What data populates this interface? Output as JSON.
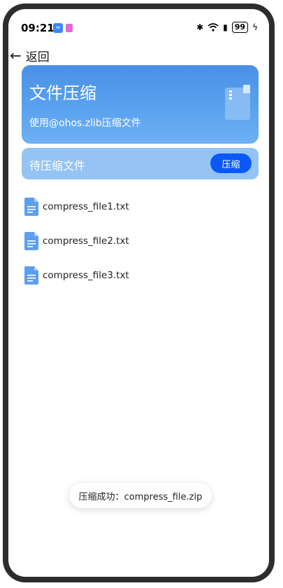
{
  "status_bar": {
    "time": "09:21",
    "battery": "99",
    "icons": [
      "bluetooth-icon",
      "wifi-icon",
      "sim-icon",
      "battery-icon",
      "charging-icon"
    ]
  },
  "nav": {
    "back_label": "返回"
  },
  "header_card": {
    "title": "文件压缩",
    "subtitle": "使用@ohos.zlib压缩文件"
  },
  "pending": {
    "label": "待压缩文件",
    "button_label": "压缩"
  },
  "files": [
    {
      "name": "compress_file1.txt"
    },
    {
      "name": "compress_file2.txt"
    },
    {
      "name": "compress_file3.txt"
    }
  ],
  "toast": {
    "message": "压缩成功：compress_file.zip"
  },
  "colors": {
    "accent": "#0a59f7",
    "card": "#4a90e6",
    "pending_bar": "#94c3f4"
  }
}
